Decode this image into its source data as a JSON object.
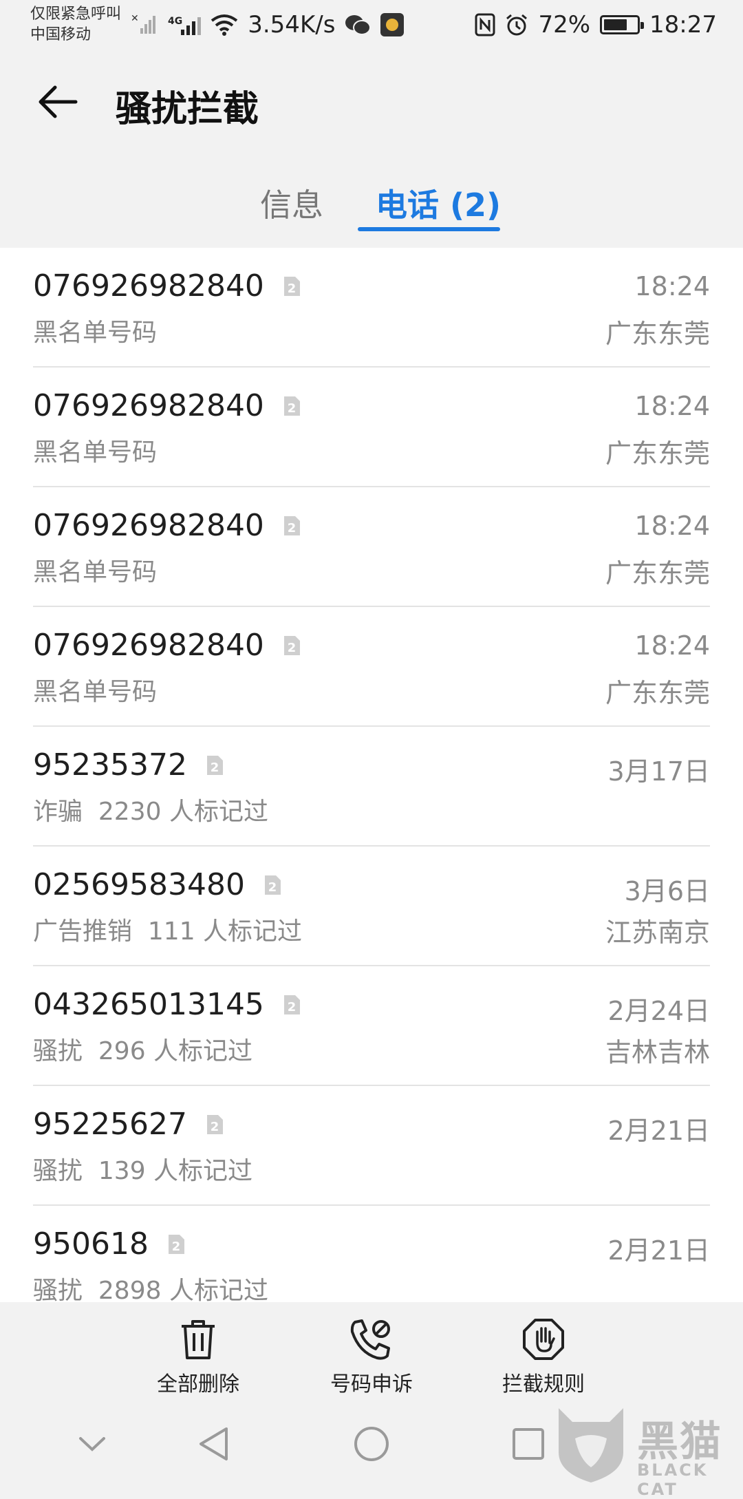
{
  "status_bar": {
    "carrier_line1": "仅限紧急呼叫",
    "carrier_line2": "中国移动",
    "network_label": "4G",
    "speed": "3.54K/s",
    "battery_percent": "72%",
    "battery_level": 0.72,
    "time": "18:27"
  },
  "header": {
    "title": "骚扰拦截"
  },
  "tabs": [
    {
      "label": "信息",
      "active": false
    },
    {
      "label": "电话 (2)",
      "active": true
    }
  ],
  "calls": [
    {
      "number": "076926982840",
      "sim": "2",
      "subtitle": "黑名单号码",
      "time": "18:24",
      "location": "广东东莞"
    },
    {
      "number": "076926982840",
      "sim": "2",
      "subtitle": "黑名单号码",
      "time": "18:24",
      "location": "广东东莞"
    },
    {
      "number": "076926982840",
      "sim": "2",
      "subtitle": "黑名单号码",
      "time": "18:24",
      "location": "广东东莞"
    },
    {
      "number": "076926982840",
      "sim": "2",
      "subtitle": "黑名单号码",
      "time": "18:24",
      "location": "广东东莞"
    },
    {
      "number": "95235372",
      "sim": "2",
      "subtitle": "诈骗  2230 人标记过",
      "time": "3月17日",
      "location": ""
    },
    {
      "number": "02569583480",
      "sim": "2",
      "subtitle": "广告推销  111 人标记过",
      "time": "3月6日",
      "location": "江苏南京"
    },
    {
      "number": "043265013145",
      "sim": "2",
      "subtitle": "骚扰  296 人标记过",
      "time": "2月24日",
      "location": "吉林吉林"
    },
    {
      "number": "95225627",
      "sim": "2",
      "subtitle": "骚扰  139 人标记过",
      "time": "2月21日",
      "location": ""
    },
    {
      "number": "950618",
      "sim": "2",
      "subtitle": "骚扰  2898 人标记过",
      "time": "2月21日",
      "location": ""
    }
  ],
  "bottom_actions": [
    {
      "label": "全部删除",
      "icon": "trash-icon"
    },
    {
      "label": "号码申诉",
      "icon": "phone-block-icon"
    },
    {
      "label": "拦截规则",
      "icon": "hand-stop-icon"
    }
  ],
  "watermark": {
    "text": "黑猫",
    "sub": "BLACK CAT"
  },
  "colors": {
    "accent": "#1d7ae0",
    "background": "#f2f2f2",
    "list_bg": "#ffffff",
    "secondary_text": "#8a8a8a"
  }
}
